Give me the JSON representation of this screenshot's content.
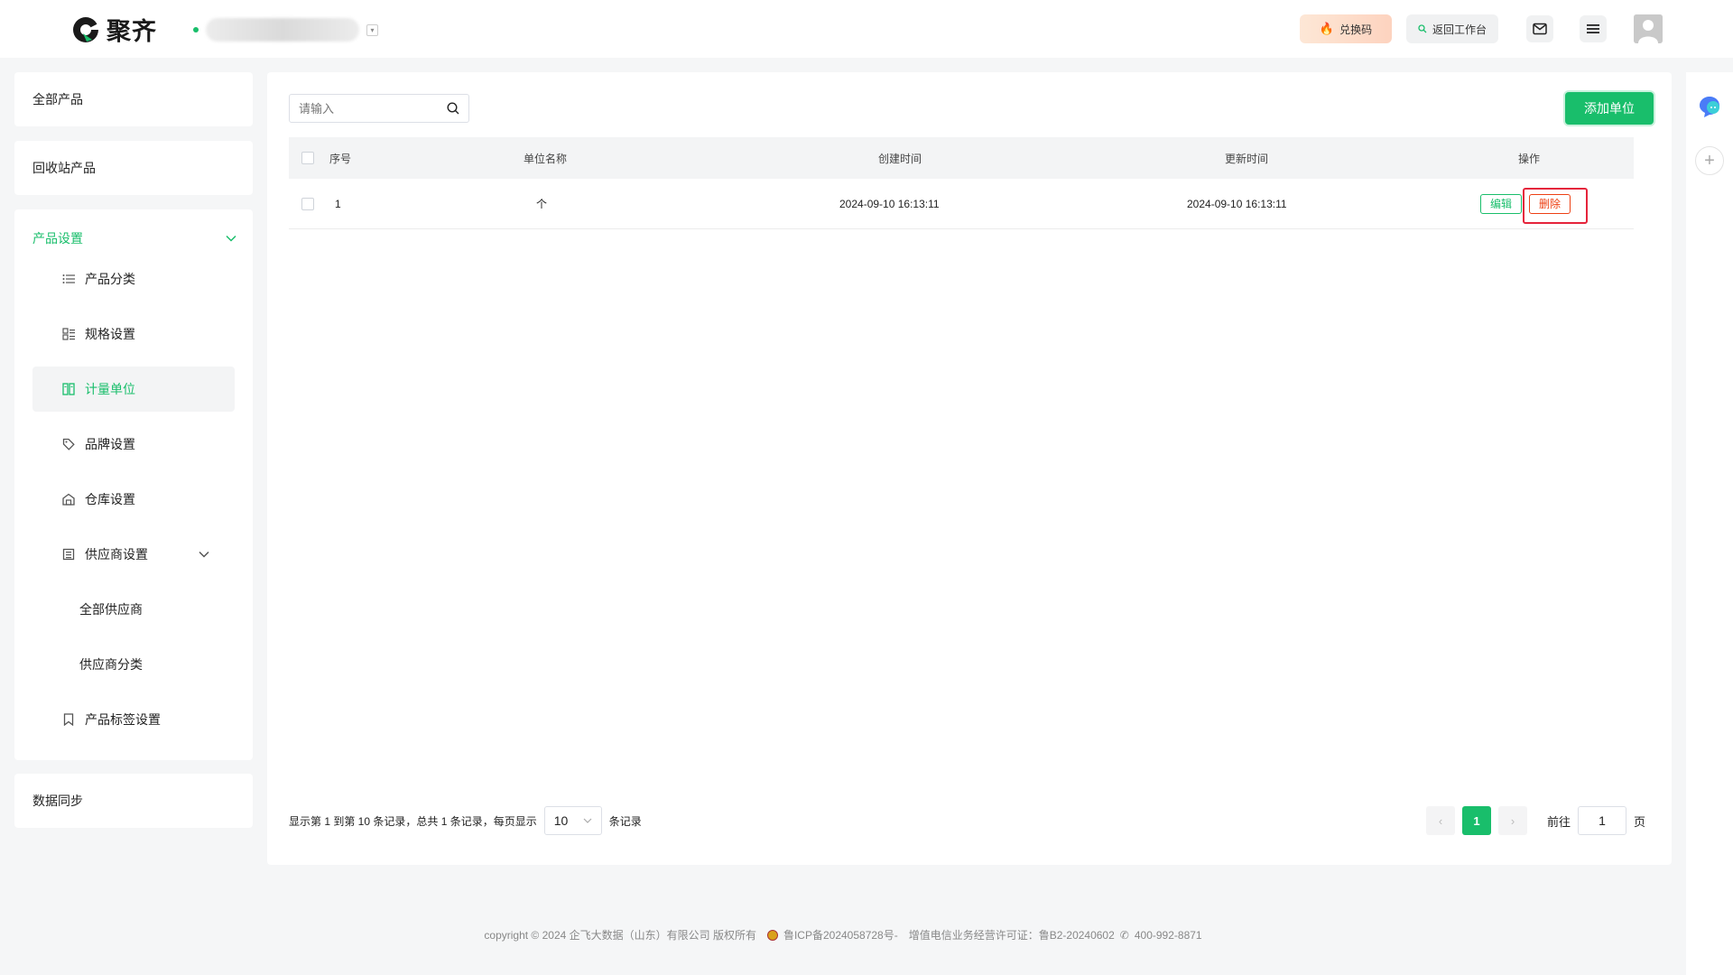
{
  "app": {
    "name": "聚齐"
  },
  "header": {
    "redeem_label": "兑换码",
    "return_label": "返回工作台"
  },
  "sidebar": {
    "all_products": "全部产品",
    "recycle_products": "回收站产品",
    "group_title": "产品设置",
    "items": [
      {
        "label": "产品分类"
      },
      {
        "label": "规格设置"
      },
      {
        "label": "计量单位"
      },
      {
        "label": "品牌设置"
      },
      {
        "label": "仓库设置"
      },
      {
        "label": "供应商设置"
      },
      {
        "label": "全部供应商"
      },
      {
        "label": "供应商分类"
      },
      {
        "label": "产品标签设置"
      }
    ],
    "data_sync": "数据同步"
  },
  "main": {
    "search_placeholder": "请输入",
    "add_button": "添加单位",
    "columns": [
      "序号",
      "单位名称",
      "创建时间",
      "更新时间",
      "操作"
    ],
    "rows": [
      {
        "index": "1",
        "name": "个",
        "created": "2024-09-10 16:13:11",
        "updated": "2024-09-10 16:13:11",
        "edit": "编辑",
        "delete": "删除"
      }
    ]
  },
  "pagination": {
    "summary": "显示第 1 到第 10 条记录，总共 1 条记录，每页显示",
    "page_size": "10",
    "suffix": "条记录",
    "prev": "‹",
    "current": "1",
    "next": "›",
    "goto_label": "前往",
    "goto_value": "1",
    "page_unit": "页"
  },
  "footer": {
    "copyright": "copyright © 2024 企飞大数据（山东）有限公司 版权所有",
    "icp": "鲁ICP备2024058728号-",
    "license": "增值电信业务经营许可证：鲁B2-20240602",
    "phone": "400-992-8871"
  },
  "colors": {
    "accent": "#19be6b",
    "danger": "#ed4014",
    "highlight": "#e5243b"
  }
}
